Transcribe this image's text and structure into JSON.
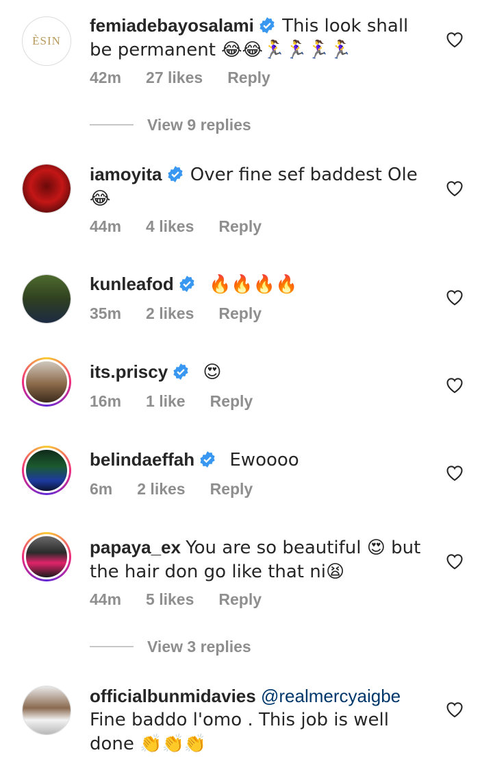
{
  "comments": [
    {
      "username": "femiadebayosalami",
      "verified": true,
      "text": "This look shall be permanent 😂😂🏃‍♀️🏃‍♀️🏃‍♀️🏃‍♀️",
      "time": "42m",
      "likes": "27 likes",
      "reply": "Reply",
      "avatar_text": "ÈSIN"
    },
    {
      "username": "iamoyita",
      "verified": true,
      "text": "Over fine sef baddest Ole 😂",
      "time": "44m",
      "likes": "4 likes",
      "reply": "Reply"
    },
    {
      "username": "kunleafod",
      "verified": true,
      "text": "🔥🔥🔥🔥",
      "time": "35m",
      "likes": "2 likes",
      "reply": "Reply"
    },
    {
      "username": "its.priscy",
      "verified": true,
      "text": "😍",
      "time": "16m",
      "likes": "1 like",
      "reply": "Reply"
    },
    {
      "username": "belindaeffah",
      "verified": true,
      "text": "Ewoooo",
      "time": "6m",
      "likes": "2 likes",
      "reply": "Reply"
    },
    {
      "username": "papaya_ex",
      "verified": false,
      "text": "You are so beautiful 😍 but the hair don go like that ni😫",
      "time": "44m",
      "likes": "5 likes",
      "reply": "Reply"
    },
    {
      "username": "officialbunmidavies",
      "verified": false,
      "mention": "@realmercyaigbe",
      "text": "Fine baddo l'omo . This job is well done 👏👏👏"
    }
  ],
  "view_replies": [
    {
      "label": "View 9 replies"
    },
    {
      "label": "View 3 replies"
    }
  ],
  "colors": {
    "verified_blue": "#3897f0",
    "secondary_text": "#8e8e8e",
    "mention": "#00376b"
  }
}
